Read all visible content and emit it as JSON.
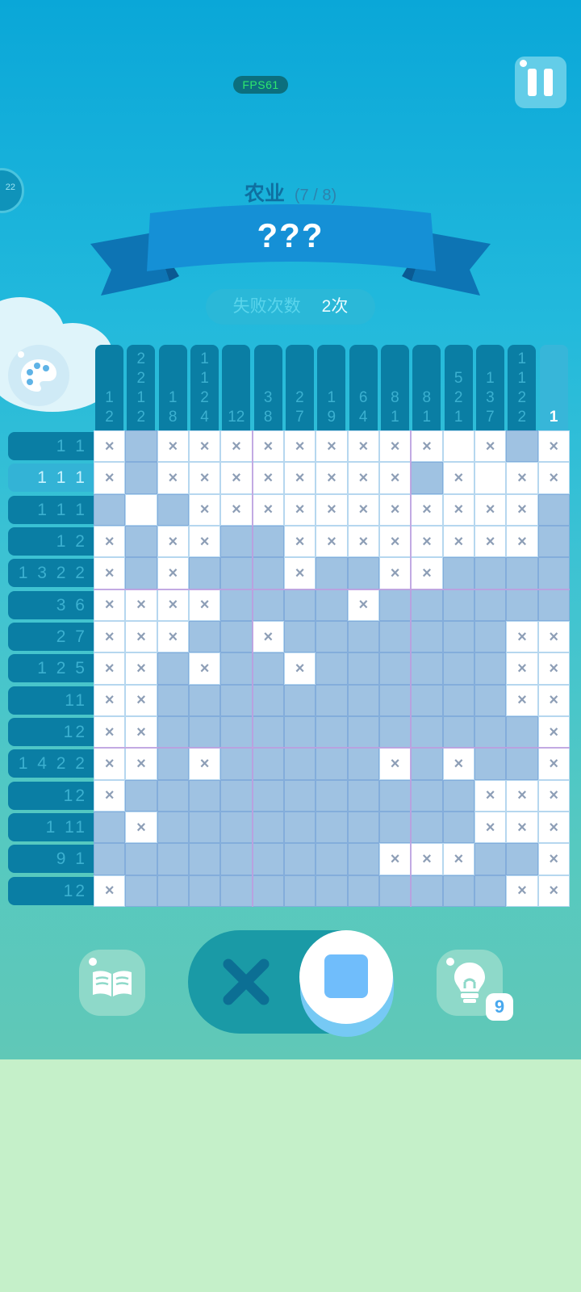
{
  "hud": {
    "fps_label": "FPS61",
    "side_token_text": "22"
  },
  "level": {
    "category": "农业",
    "progress": "(7 / 8)",
    "title": "???"
  },
  "failures": {
    "label": "失败次数",
    "value": "2次"
  },
  "column_clues": [
    [
      "1",
      "2"
    ],
    [
      "2",
      "2",
      "1",
      "2"
    ],
    [
      "1",
      "8"
    ],
    [
      "1",
      "1",
      "2",
      "4"
    ],
    [
      "12"
    ],
    [
      "3",
      "8"
    ],
    [
      "2",
      "7"
    ],
    [
      "1",
      "9"
    ],
    [
      "6",
      "4"
    ],
    [
      "8",
      "1"
    ],
    [
      "8",
      "1"
    ],
    [
      "5",
      "2",
      "1"
    ],
    [
      "1",
      "3",
      "7"
    ],
    [
      "1",
      "1",
      "2",
      "2"
    ],
    [
      "1"
    ]
  ],
  "active_column": 14,
  "row_clues": [
    "1 1",
    "1 1 1",
    "1 1 1",
    "1 2",
    "1 3 2 2",
    "3 6",
    "2 7",
    "1 2 5",
    "11",
    "12",
    "1 4 2 2",
    "12",
    "1 11",
    "9 1",
    "12"
  ],
  "active_row": 1,
  "grid": [
    ".#.........x.#.",
    ".#........#.x..",
    "#x#...........#",
    ".#..##........#",
    ".#.###.##..####",
    "....####.######",
    "...##.#######..",
    "..#.##.######..",
    "..###########..",
    "..############.",
    "..#.#####.#.##.",
    ".###########...",
    "#.##########...",
    "#########...##.",
    ".############.."
  ],
  "grid_notes": "# = filled cell, . = marked with ×",
  "controls": {
    "mode_cross_icon": "cross-icon",
    "mode_fill_icon": "square-icon",
    "hint_count": "9"
  }
}
